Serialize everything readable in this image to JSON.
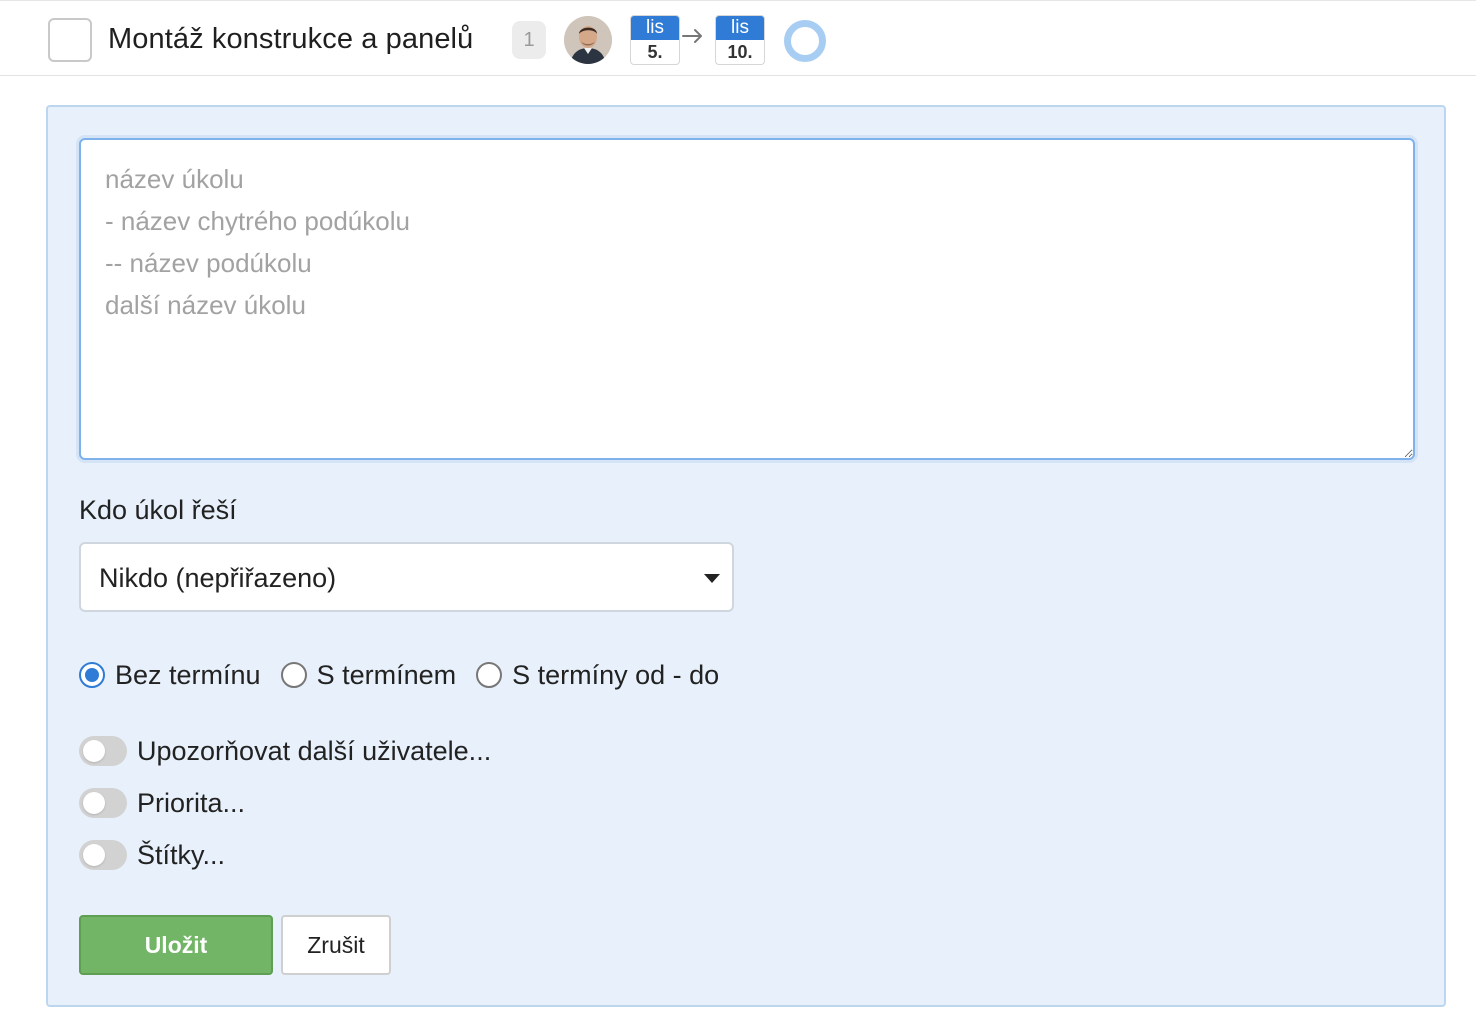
{
  "task": {
    "title": "Montáž konstrukce a panelů",
    "comment_count": "1",
    "start_date": {
      "month": "lis",
      "day": "5."
    },
    "end_date": {
      "month": "lis",
      "day": "10."
    },
    "status_color": "#a8cdf3"
  },
  "form": {
    "textarea_placeholder": "název úkolu\n- název chytrého podúkolu\n-- název podúkolu\ndalší název úkolu",
    "assignee_label": "Kdo úkol řeší",
    "assignee_value": "Nikdo (nepřiřazeno)",
    "deadline_options": [
      {
        "label": "Bez termínu",
        "checked": true
      },
      {
        "label": "S termínem",
        "checked": false
      },
      {
        "label": "S termíny od - do",
        "checked": false
      }
    ],
    "toggles": [
      {
        "label": "Upozorňovat další uživatele...",
        "on": false
      },
      {
        "label": "Priorita...",
        "on": false
      },
      {
        "label": "Štítky...",
        "on": false
      }
    ],
    "save_label": "Uložit",
    "cancel_label": "Zrušit"
  },
  "colors": {
    "accent": "#2f7bd6",
    "save": "#72b566",
    "panel_bg": "#e8f1fb"
  }
}
